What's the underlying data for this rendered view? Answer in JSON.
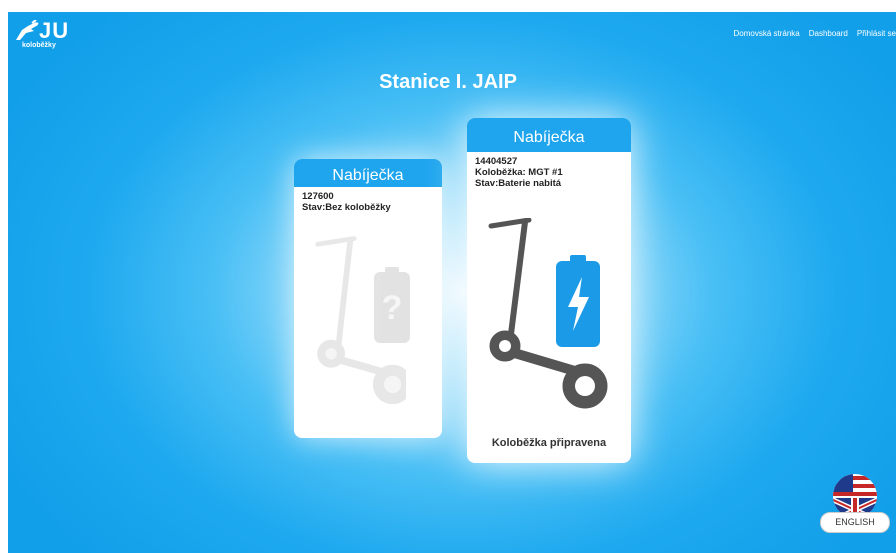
{
  "logo": {
    "brand": "JU",
    "sub": "koloběžky",
    "icon": "plug-scooter-icon"
  },
  "nav": [
    {
      "label": "Domovská stránka"
    },
    {
      "label": "Dashboard"
    },
    {
      "label": "Přihlásit se"
    }
  ],
  "page": {
    "title": "Stanice I. JAIP"
  },
  "chargers": [
    {
      "header": "Nabíječka",
      "id": "127600",
      "status": "Stav:Bez koloběžky",
      "icon": "unknown-battery-icon",
      "footer": ""
    },
    {
      "header": "Nabíječka",
      "id": "14404527",
      "scooter": "Koloběžka: MGT #1",
      "status": "Stav:Baterie nabitá",
      "icon": "charged-battery-icon",
      "footer": "Koloběžka připravena"
    }
  ],
  "language": {
    "label": "ENGLISH",
    "icon": "uk-us-flag-icon"
  },
  "colors": {
    "primary": "#1ea5ee",
    "battery": "#1b9ae8"
  }
}
